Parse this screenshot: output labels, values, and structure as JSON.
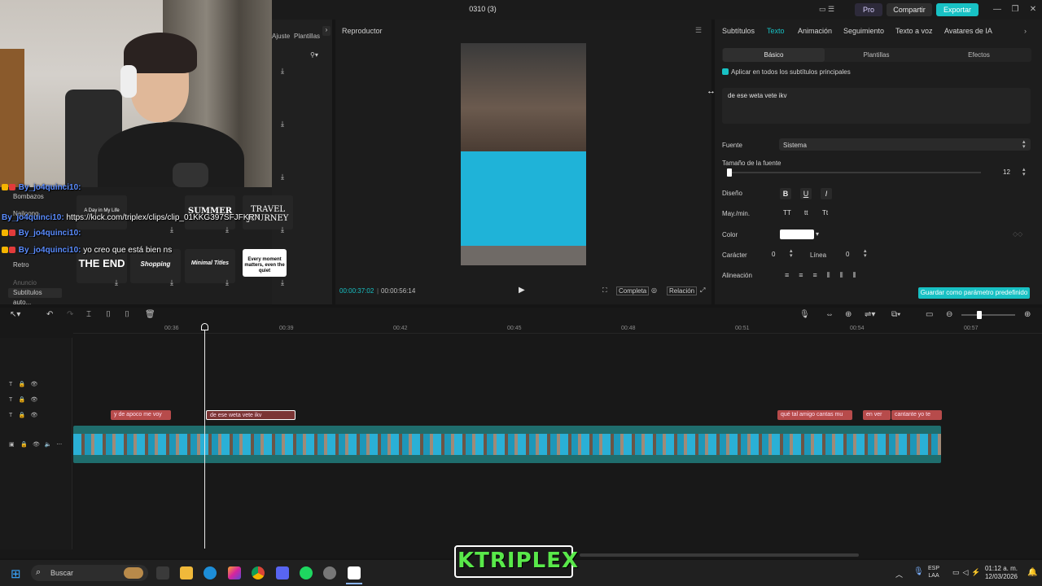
{
  "window": {
    "title": "0310 (3)",
    "pro_label": "Pro",
    "share_label": "Compartir",
    "export_label": "Exportar",
    "minimize": "—",
    "maximize": "❐",
    "close": "✕"
  },
  "left_panel": {
    "tabs": [
      "Ajuste",
      "Plantillas"
    ],
    "side_items": [
      "Bombazos",
      "Nailoong",
      "Retro",
      "Subtítulos auto...",
      "Anuncio"
    ],
    "templates": [
      {
        "label": "A Day in My Life"
      },
      {
        "label": "SUMMER"
      },
      {
        "label": "TRAVEL JOURNEY"
      },
      {
        "label": "THE END"
      },
      {
        "label": "Shopping"
      },
      {
        "label": "Minimal Titles"
      },
      {
        "label": "Every moment matters, even the quiet"
      }
    ]
  },
  "chat": [
    {
      "user": "By_jo4quinci10:",
      "text": ""
    },
    {
      "user": "By_jo4quinci10:",
      "text": "https://kick.com/triplex/clips/clip_01KKG397SFJFKRN"
    },
    {
      "user": "By_jo4quinci10:",
      "text": ""
    },
    {
      "user": "By_jo4quinci10:",
      "text": "yo creo que está bien ns"
    }
  ],
  "player": {
    "title": "Reproductor",
    "time_current": "00:00:37:02",
    "time_total": "00:00:56:14",
    "ctl_full": "Completa",
    "ctl_ratio": "Relación"
  },
  "right_panel": {
    "tabs": [
      "Subtítulos",
      "Texto",
      "Animación",
      "Seguimiento",
      "Texto a voz",
      "Avatares de IA"
    ],
    "active_tab": "Texto",
    "subtabs": [
      "Básico",
      "Plantillas",
      "Efectos"
    ],
    "apply_all_label": "Aplicar en todos los subtítulos principales",
    "text_value": "de ese weta vete ikv",
    "font_label": "Fuente",
    "font_value": "Sistema",
    "size_label": "Tamaño de la fuente",
    "size_value": "12",
    "design_label": "Diseño",
    "case_label": "May./min.",
    "case_options": [
      "TT",
      "tt",
      "Tt"
    ],
    "color_label": "Color",
    "char_label": "Carácter",
    "char_value": "0",
    "line_label": "Línea",
    "line_value": "0",
    "align_label": "Alineación",
    "save_default_label": "Guardar como parámetro predefinido",
    "bold": "B",
    "underline": "U",
    "italic": "I"
  },
  "timeline": {
    "ticks": [
      "00:36",
      "00:39",
      "00:42",
      "00:45",
      "00:48",
      "00:51",
      "00:54",
      "00:57"
    ],
    "clips": [
      {
        "label": "y de apoco me voy"
      },
      {
        "label": "de ese weta vete ikv"
      },
      {
        "label": "qué tal amigo cantas mu"
      },
      {
        "label": "en ver"
      },
      {
        "label": "cantante yo te"
      }
    ]
  },
  "taskbar": {
    "search_placeholder": "Buscar",
    "lang_top": "ESP",
    "lang_bottom": "LAA",
    "time": "01:12 a. m.",
    "date": "12/03/2026"
  },
  "overlay_logo": "KTRIPLEX",
  "colors": {
    "accent": "#18c1c4",
    "clip": "#b74b4b",
    "video_track": "#1f6d6d"
  }
}
